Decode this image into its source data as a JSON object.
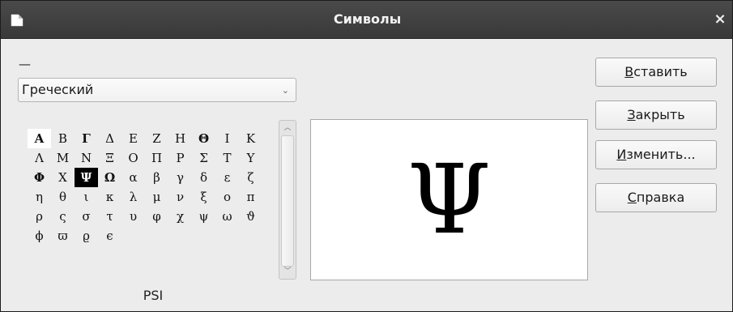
{
  "window": {
    "title": "Символы",
    "close_glyph": "×"
  },
  "font": {
    "label": "—"
  },
  "subset": {
    "selected": "Греческий",
    "arrow_glyph": "⌄"
  },
  "symbols": [
    "Α",
    "Β",
    "Γ",
    "Δ",
    "Ε",
    "Ζ",
    "Η",
    "Θ",
    "Ι",
    "Κ",
    "Λ",
    "Μ",
    "Ν",
    "Ξ",
    "Ο",
    "Π",
    "Ρ",
    "Σ",
    "Τ",
    "Υ",
    "Φ",
    "Χ",
    "Ψ",
    "Ω",
    "α",
    "β",
    "γ",
    "δ",
    "ε",
    "ζ",
    "η",
    "θ",
    "ι",
    "κ",
    "λ",
    "μ",
    "ν",
    "ξ",
    "ο",
    "π",
    "ρ",
    "ς",
    "σ",
    "τ",
    "υ",
    "φ",
    "χ",
    "ψ",
    "ω",
    "ϑ",
    "ϕ",
    "ϖ",
    "ϱ",
    "ϵ"
  ],
  "selected_symbol": "Ψ",
  "selected_name": "PSI",
  "buttons": {
    "insert": {
      "key": "В",
      "rest": "ставить"
    },
    "close": {
      "key": "З",
      "rest": "акрыть"
    },
    "modify": {
      "key": "И",
      "rest": "зменить..."
    },
    "help": {
      "key": "С",
      "rest": "правка"
    }
  },
  "scrollbar": {
    "up_glyph": "︿",
    "down_glyph": "﹀"
  },
  "colors": {
    "titlebar": "#3e3e3e",
    "dialog_bg": "#ececec",
    "selection_bg": "#000000",
    "selection_fg": "#ffffff"
  }
}
